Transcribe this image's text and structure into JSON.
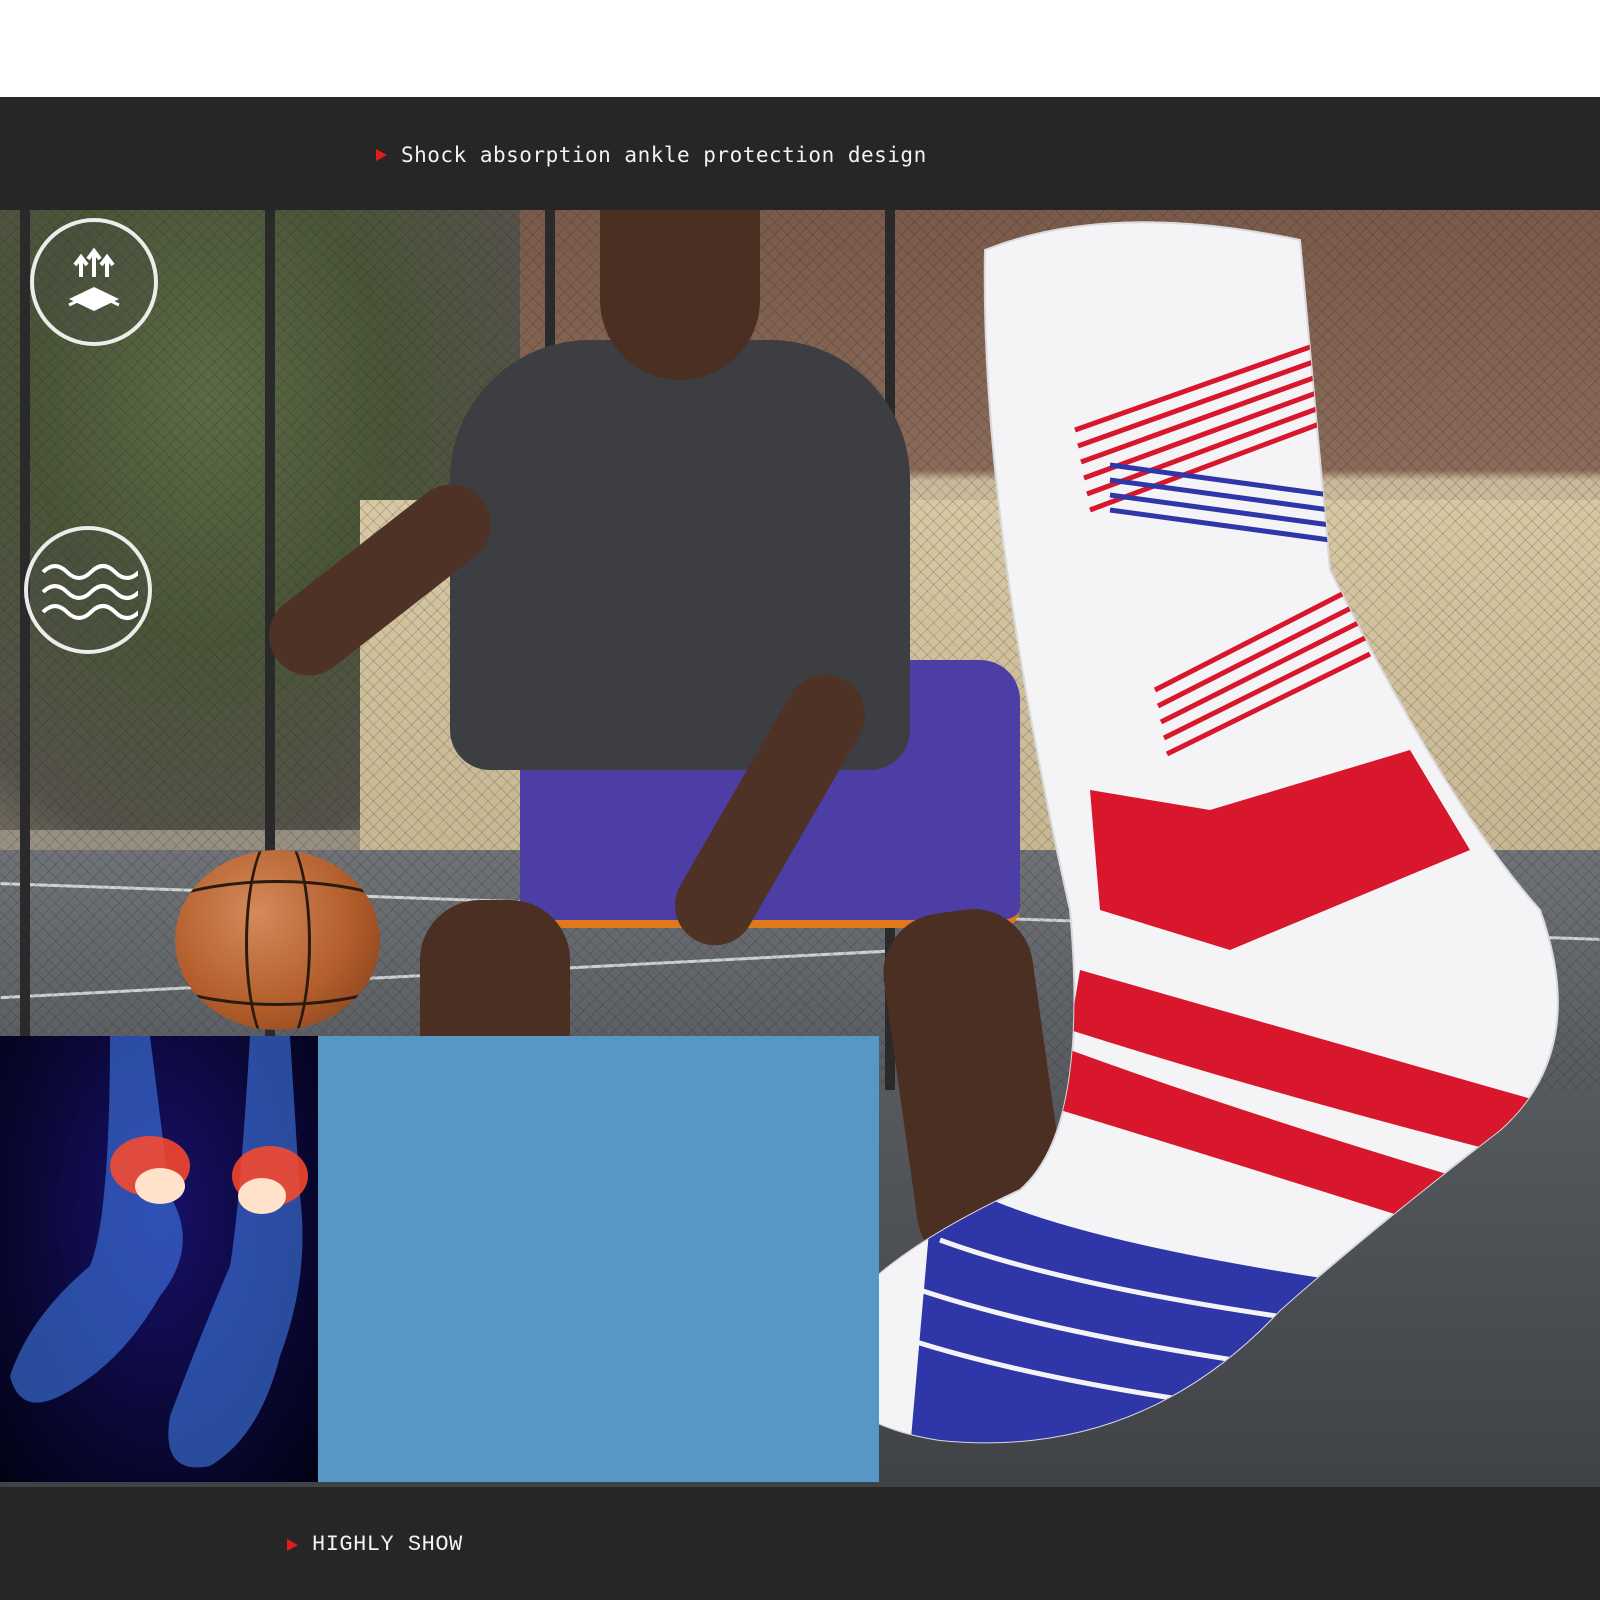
{
  "header": {
    "caption": "Shock absorption ankle protection design"
  },
  "footer": {
    "caption": "HIGHLY SHOW"
  },
  "colors": {
    "band": "#262626",
    "arrow": "#e21b1b",
    "sock_red": "#d8162c",
    "sock_blue": "#2f36a8",
    "blue_panel": "#5797c5"
  },
  "icons": [
    "up-arrows-layers-icon",
    "waves-icon"
  ]
}
